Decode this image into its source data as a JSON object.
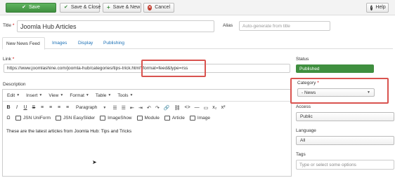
{
  "toolbar": {
    "save": "Save",
    "save_close": "Save & Close",
    "save_new": "Save & New",
    "cancel": "Cancel",
    "help": "Help"
  },
  "form": {
    "title_label": "Title *",
    "title_value": "Joomla Hub Articles",
    "alias_label": "Alias",
    "alias_placeholder": "Auto-generate from title",
    "link_label": "Link *",
    "link_value": "https://www.joomlashine.com/joomla-hub/categories/tips-trick.html?format=feed&type=rss",
    "description_label": "Description"
  },
  "tabs": [
    "New News Feed",
    "Images",
    "Display",
    "Publishing"
  ],
  "editor": {
    "menus": [
      "Edit",
      "Insert",
      "View",
      "Format",
      "Table",
      "Tools"
    ],
    "row1": [
      "B",
      "I",
      "U",
      "S",
      "≡",
      "≡",
      "≡",
      "≡"
    ],
    "paragraph": "Paragraph",
    "row1_tail": [
      "☰",
      "☰",
      "⇤",
      "⇥",
      "↶",
      "↷",
      "🔗",
      "⛓",
      "<>",
      "—",
      "▭",
      "x₂",
      "x²"
    ],
    "plugins": [
      "JSN UniForm",
      "JSN EasySlider",
      "ImageShow",
      "Module",
      "Article",
      "Image"
    ],
    "omega": "Ω",
    "content": "These are the latest articles from Joomla Hub: Tips and Tricks"
  },
  "sidebar": {
    "status_label": "Status",
    "status_value": "Published",
    "category_label": "Category *",
    "category_value": "- News",
    "access_label": "Access",
    "access_value": "Public",
    "language_label": "Language",
    "language_value": "All",
    "tags_label": "Tags",
    "tags_placeholder": "Type or select some options"
  },
  "colors": {
    "accent_green": "#3f8f3f",
    "highlight_red": "#d9534f",
    "link_blue": "#1a6fb5"
  }
}
